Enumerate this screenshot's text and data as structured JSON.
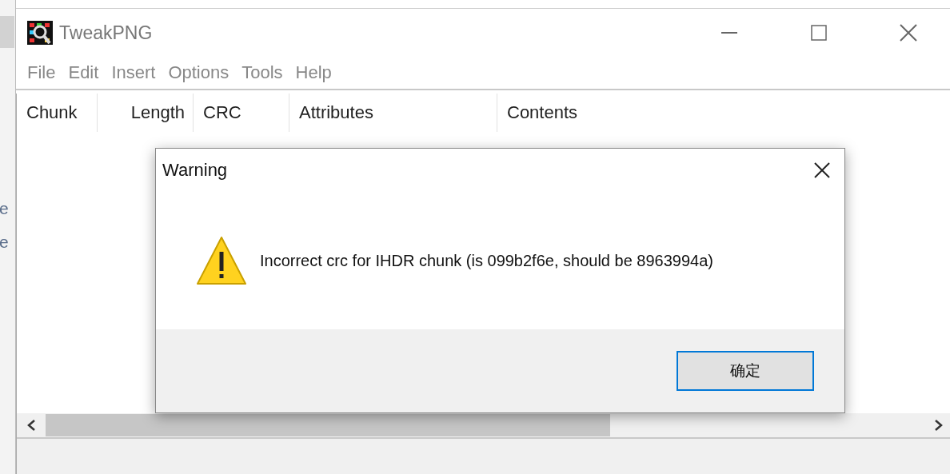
{
  "background_window": {
    "fragments": [
      "e",
      "e"
    ]
  },
  "window": {
    "title": "TweakPNG"
  },
  "menu": [
    "File",
    "Edit",
    "Insert",
    "Options",
    "Tools",
    "Help"
  ],
  "table": {
    "columns": [
      "Chunk",
      "Length",
      "CRC",
      "Attributes",
      "Contents"
    ]
  },
  "dialog": {
    "title": "Warning",
    "message": "Incorrect crc for IHDR chunk (is 099b2f6e, should be 8963994a)",
    "buttons": [
      {
        "label": "确定",
        "default": true
      }
    ]
  }
}
